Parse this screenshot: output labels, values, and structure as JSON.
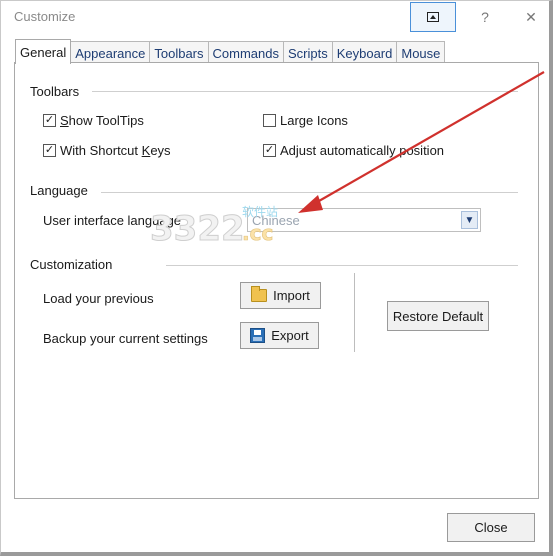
{
  "window": {
    "title": "Customize",
    "help_symbol": "?",
    "close_symbol": "✕"
  },
  "tabs": [
    {
      "label": "General",
      "active": true
    },
    {
      "label": "Appearance"
    },
    {
      "label": "Toolbars"
    },
    {
      "label": "Commands"
    },
    {
      "label": "Scripts"
    },
    {
      "label": "Keyboard"
    },
    {
      "label": "Mouse"
    }
  ],
  "toolbars": {
    "heading": "Toolbars",
    "show_tooltips": {
      "label_u": "S",
      "label_rest": "how ToolTips",
      "checked": true
    },
    "large_icons": {
      "label": "Large Icons",
      "checked": false
    },
    "with_shortcut_keys": {
      "label_pre": "With Shortcut ",
      "label_u": "K",
      "label_rest": "eys",
      "checked": true
    },
    "adjust_position": {
      "label": "Adjust automatically position",
      "checked": true
    }
  },
  "language": {
    "heading": "Language",
    "ui_language_label": "User interface language",
    "selected": "Chinese"
  },
  "customization": {
    "heading": "Customization",
    "load_label": "Load your previous",
    "import_label": "Import",
    "backup_label": "Backup your current settings",
    "export_label": "Export",
    "restore_label": "Restore Default"
  },
  "footer": {
    "close_label": "Close"
  },
  "watermark": {
    "text": "3322.cc",
    "cn_text": "软件站"
  },
  "colors": {
    "arrow": "#d0312d",
    "accent": "#4a90d9"
  }
}
